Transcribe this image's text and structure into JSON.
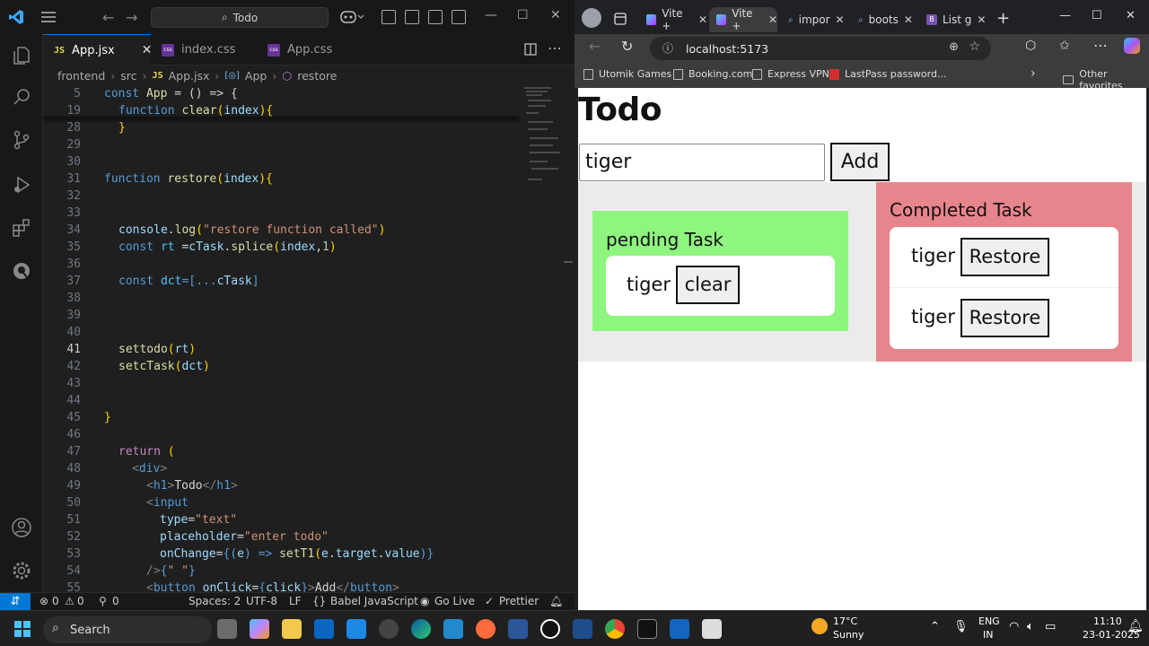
{
  "vscode": {
    "search_text": "Todo",
    "tabs": [
      {
        "label": "App.jsx",
        "badge": "JS"
      },
      {
        "label": "index.css",
        "badge": "css"
      },
      {
        "label": "App.css",
        "badge": "css"
      }
    ],
    "breadcrumb": [
      "frontend",
      "src",
      "App.jsx",
      "App",
      "restore"
    ],
    "breadcrumb_badges": {
      "js": "JS",
      "app": "[◎]"
    },
    "lines": [
      {
        "n": "5"
      },
      {
        "n": "19"
      },
      {
        "n": "28"
      },
      {
        "n": "29"
      },
      {
        "n": "30"
      },
      {
        "n": "31"
      },
      {
        "n": "32"
      },
      {
        "n": "33"
      },
      {
        "n": "34"
      },
      {
        "n": "35"
      },
      {
        "n": "36"
      },
      {
        "n": "37"
      },
      {
        "n": "38"
      },
      {
        "n": "39"
      },
      {
        "n": "40"
      },
      {
        "n": "41"
      },
      {
        "n": "42"
      },
      {
        "n": "43"
      },
      {
        "n": "44"
      },
      {
        "n": "45"
      },
      {
        "n": "46"
      },
      {
        "n": "47"
      },
      {
        "n": "48"
      },
      {
        "n": "49"
      },
      {
        "n": "50"
      },
      {
        "n": "51"
      },
      {
        "n": "52"
      },
      {
        "n": "53"
      },
      {
        "n": "54"
      },
      {
        "n": "55"
      }
    ],
    "code": {
      "l5": [
        "const",
        " ",
        "App",
        " = () => {"
      ],
      "l19": [
        "function",
        " ",
        "clear",
        "(",
        "index",
        "){"
      ],
      "l28": [
        "}"
      ],
      "l31": [
        "function",
        " ",
        "restore",
        "(",
        "index",
        "){"
      ],
      "l34": [
        "console",
        ".",
        "log",
        "(",
        "\"restore function called\"",
        ")"
      ],
      "l35": [
        "const",
        " ",
        "rt",
        " =",
        "cTask",
        ".",
        "splice",
        "(",
        "index",
        ",",
        "1",
        ")"
      ],
      "l37": [
        "const",
        " ",
        "dct",
        "=[...",
        "cTask",
        "]"
      ],
      "l41": [
        "settodo",
        "(",
        "rt",
        ")"
      ],
      "l42": [
        "setcTask",
        "(",
        "dct",
        ")"
      ],
      "l45": [
        "}"
      ],
      "l47": [
        "return",
        " ("
      ],
      "l48": [
        "<",
        "div",
        ">"
      ],
      "l49": [
        "<",
        "h1",
        ">",
        "Todo",
        "</",
        "h1",
        ">"
      ],
      "l50": [
        "<",
        "input"
      ],
      "l51": [
        "type",
        "=",
        "\"text\""
      ],
      "l52": [
        "placeholder",
        "=",
        "\"enter todo\""
      ],
      "l53": [
        "onChange",
        "=",
        "{(",
        "e",
        ") => ",
        "setT1",
        "(",
        "e",
        ".",
        "target",
        ".",
        "value",
        ")}"
      ],
      "l54": [
        "/>",
        "{",
        "\" \"",
        "}"
      ],
      "l55": [
        "<",
        "button",
        " ",
        "onClick",
        "=",
        "{",
        "click",
        "}",
        ">",
        "Add",
        "</",
        "button",
        ">"
      ]
    },
    "status": {
      "errors": "0",
      "warnings": "0",
      "ports": "0",
      "spaces": "Spaces: 2",
      "encoding": "UTF-8",
      "eol": "LF",
      "language": "Babel JavaScript",
      "golive": "Go Live",
      "prettier": "Prettier"
    }
  },
  "browser": {
    "tabs": [
      "Vite +",
      "Vite +",
      "impor",
      "boots",
      "List g"
    ],
    "url": "localhost:5173",
    "bookmarks": [
      "Utomik Games",
      "Booking.com",
      "Express VPN",
      "LastPass password...",
      "Other favorites"
    ],
    "app": {
      "title": "Todo",
      "input_value": "tiger",
      "add_label": "Add",
      "pending_title": "pending Task",
      "pending_items": [
        {
          "text": "tiger",
          "button": "clear"
        }
      ],
      "completed_title": "Completed Task",
      "completed_items": [
        {
          "text": "tiger",
          "button": "Restore"
        },
        {
          "text": "tiger",
          "button": "Restore"
        }
      ],
      "colors": {
        "pending": "#8ef57f",
        "completed": "#e7858c"
      }
    }
  },
  "taskbar": {
    "search": "Search",
    "weather_temp": "17°C",
    "weather_desc": "Sunny",
    "lang1": "ENG",
    "lang2": "IN",
    "time": "11:10",
    "date": "23-01-2025"
  }
}
